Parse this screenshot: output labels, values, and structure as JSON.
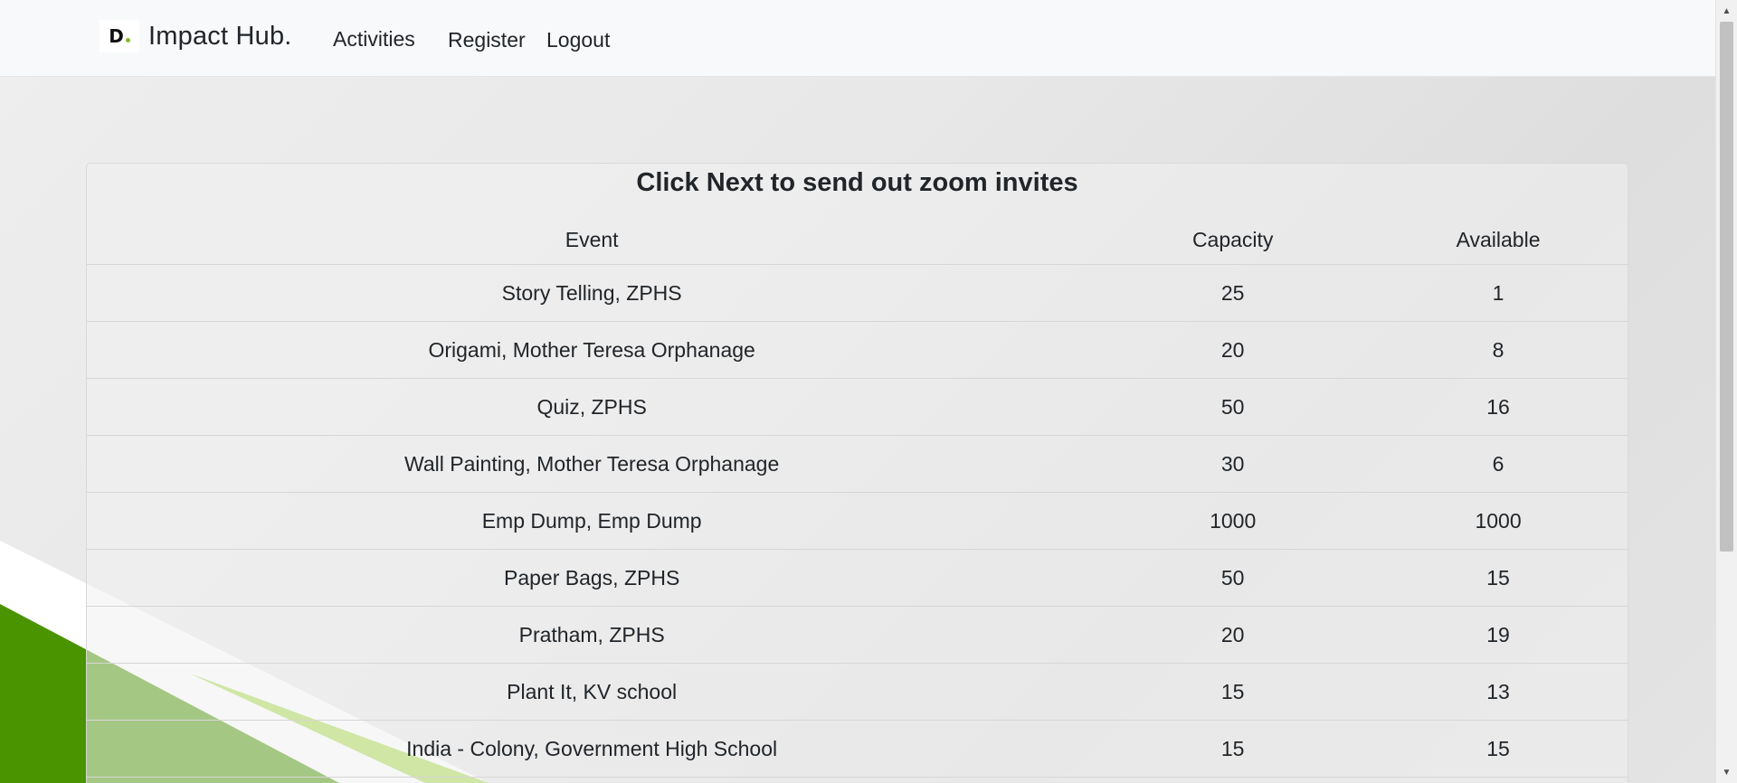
{
  "navbar": {
    "brand_logo_letter": "D",
    "brand_name": "Impact Hub.",
    "links": {
      "activities": "Activities",
      "register": "Register",
      "logout": "Logout"
    }
  },
  "main": {
    "title": "Click Next to send out zoom invites",
    "table": {
      "headers": {
        "event": "Event",
        "capacity": "Capacity",
        "available": "Available"
      },
      "rows": [
        {
          "event": "Story Telling, ZPHS",
          "capacity": "25",
          "available": "1"
        },
        {
          "event": "Origami, Mother Teresa Orphanage",
          "capacity": "20",
          "available": "8"
        },
        {
          "event": "Quiz, ZPHS",
          "capacity": "50",
          "available": "16"
        },
        {
          "event": "Wall Painting, Mother Teresa Orphanage",
          "capacity": "30",
          "available": "6"
        },
        {
          "event": "Emp Dump, Emp Dump",
          "capacity": "1000",
          "available": "1000"
        },
        {
          "event": "Paper Bags, ZPHS",
          "capacity": "50",
          "available": "15"
        },
        {
          "event": "Pratham, ZPHS",
          "capacity": "20",
          "available": "19"
        },
        {
          "event": "Plant It, KV school",
          "capacity": "15",
          "available": "13"
        },
        {
          "event": "India - Colony, Government High School",
          "capacity": "15",
          "available": "15"
        }
      ]
    }
  },
  "colors": {
    "brand_green": "#86bc25",
    "dark_green": "#4a9400",
    "navbar_bg": "#f8f9fa"
  },
  "icons": {
    "scroll_up": "triangle-up-icon",
    "scroll_down": "triangle-down-icon"
  }
}
